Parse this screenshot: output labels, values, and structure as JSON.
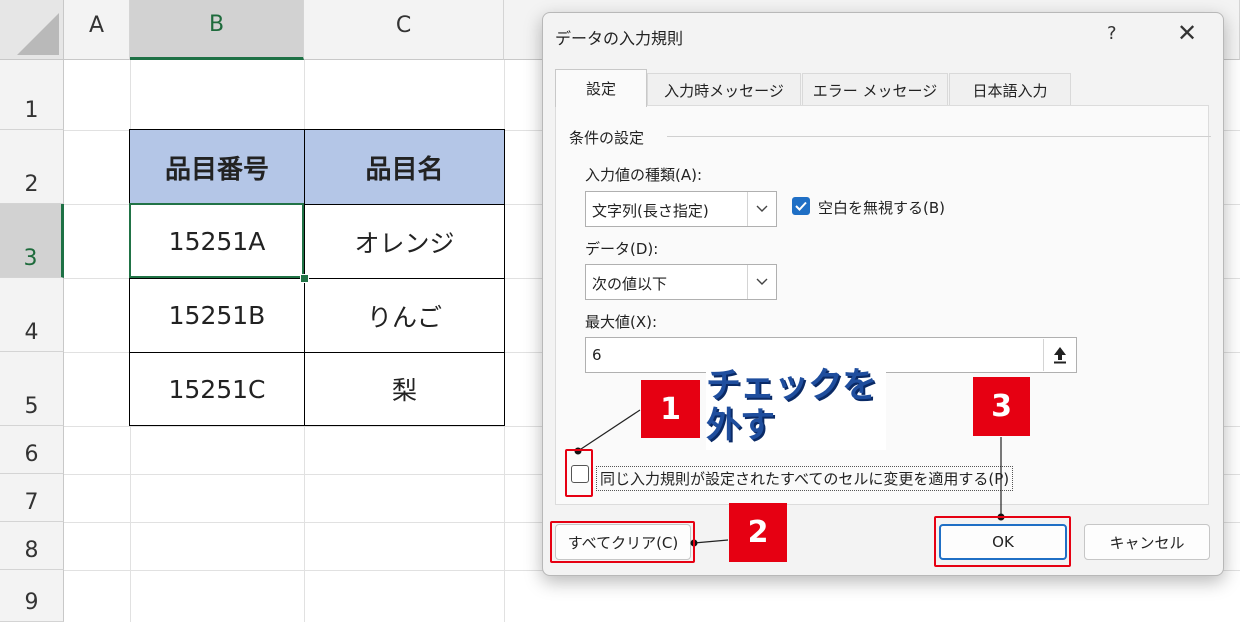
{
  "sheet": {
    "columns": [
      "A",
      "B",
      "C"
    ],
    "rows": [
      "1",
      "2",
      "3",
      "4",
      "5",
      "6",
      "7",
      "8",
      "9"
    ],
    "table": {
      "headers": [
        "品目番号",
        "品目名"
      ],
      "rows": [
        [
          "15251A",
          "オレンジ"
        ],
        [
          "15251B",
          "りんご"
        ],
        [
          "15251C",
          "梨"
        ]
      ]
    }
  },
  "dialog": {
    "title": "データの入力規則",
    "help": "?",
    "close": "✕",
    "tabs": [
      "設定",
      "入力時メッセージ",
      "エラー メッセージ",
      "日本語入力"
    ],
    "group_title": "条件の設定",
    "allow_label": "入力値の種類(A):",
    "allow_value": "文字列(長さ指定)",
    "ignore_blank_label": "空白を無視する(B)",
    "data_label": "データ(D):",
    "data_value": "次の値以下",
    "max_label": "最大値(X):",
    "max_value": "6",
    "apply_all_label": "同じ入力規則が設定されたすべてのセルに変更を適用する(P)",
    "clear_all_label": "すべてクリア(C)",
    "ok_label": "OK",
    "cancel_label": "キャンセル"
  },
  "annotations": {
    "badge1": "1",
    "badge2": "2",
    "badge3": "3",
    "callout_line1": "チェックを",
    "callout_line2": "外す"
  },
  "colors": {
    "accent": "#e60012",
    "table_header": "#b4c6e7",
    "excel_green": "#217346",
    "checkbox_blue": "#1f6fc5"
  }
}
